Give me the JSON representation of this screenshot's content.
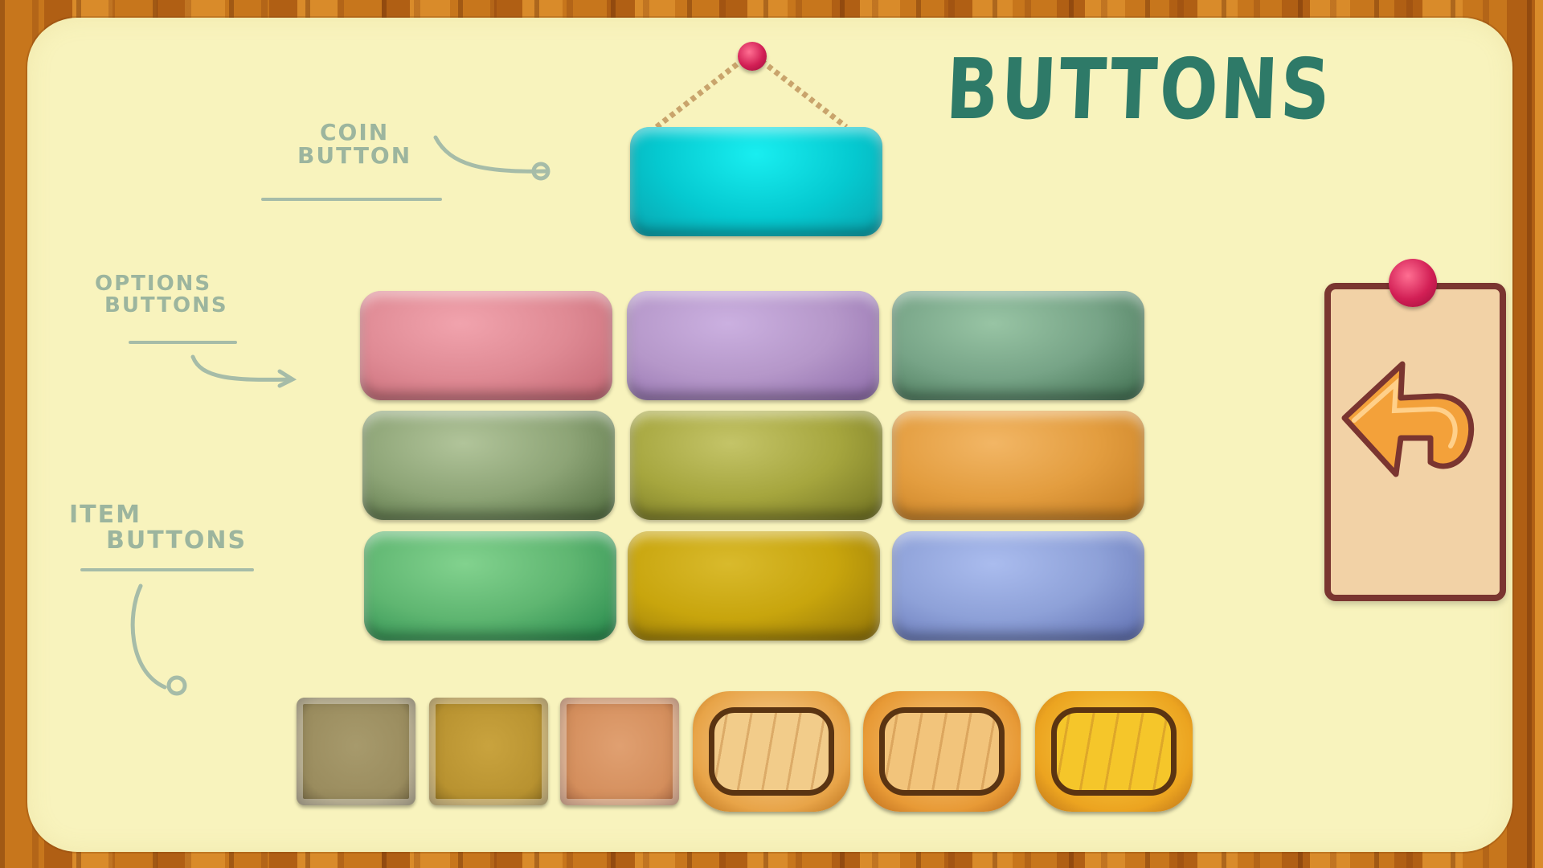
{
  "title": "BUTTONS",
  "notes": {
    "coin": {
      "line1": "COIN",
      "line2": "BUTTON"
    },
    "options": {
      "line1": "OPTIONS",
      "line2": "BUTTONS"
    },
    "item": {
      "line1": "ITEM",
      "line2": "BUTTONS"
    }
  },
  "colors": {
    "board": "#f8f3bd",
    "title": "#2e7a68",
    "coin_button": "#07d6dc",
    "options": [
      "#df8a94",
      "#b597c9",
      "#77a487",
      "#8da476",
      "#a6a63e",
      "#e39d3f",
      "#5fb671",
      "#c8a50d",
      "#8ea1d8"
    ],
    "items": [
      "#a79a6c",
      "#c9a33e",
      "#e0a071"
    ],
    "wood_buttons": [
      "#f2cc8a",
      "#f2c47b",
      "#f5c62a"
    ],
    "pin": "#d21f55"
  },
  "icons": {
    "back": "back-arrow-icon"
  }
}
